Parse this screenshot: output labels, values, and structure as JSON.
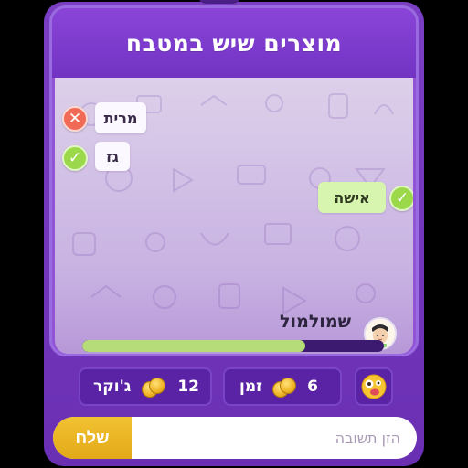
{
  "game": {
    "category_title": "מוצרים שיש במטבח"
  },
  "guesses": [
    {
      "text": "מרית",
      "status": "wrong",
      "icon": "x-icon"
    },
    {
      "text": "גז",
      "status": "correct",
      "icon": "check-icon"
    },
    {
      "text": "אישה",
      "status": "correct",
      "icon": "check-icon"
    }
  ],
  "player": {
    "name": "שמולמול",
    "progress": 0.74
  },
  "stats": {
    "joker_label": "ג'וקר",
    "joker_count": "12",
    "time_label": "זמן",
    "time_count": "6"
  },
  "answer": {
    "placeholder": "הזן תשובה",
    "send_label": "שלח"
  },
  "colors": {
    "frame": "#6a2fb3",
    "header": "#7233c3",
    "correct": "#9bd84a",
    "wrong": "#f06a55",
    "send": "#e2a918",
    "progress_fill": "#b6dc7a"
  }
}
